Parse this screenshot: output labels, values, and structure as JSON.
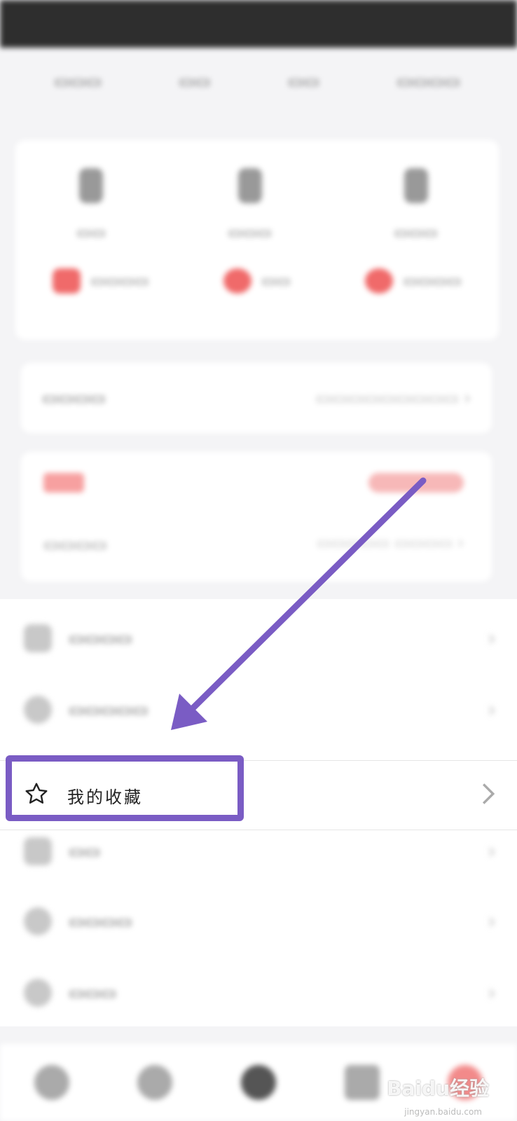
{
  "highlighted_item": {
    "label": "我的收藏",
    "icon": "star-icon"
  },
  "watermark": {
    "brand": "Baidu经验",
    "url": "jingyan.baidu.com"
  },
  "colors": {
    "highlight": "#7a5cc4",
    "accent_red": "#f06a6a"
  }
}
